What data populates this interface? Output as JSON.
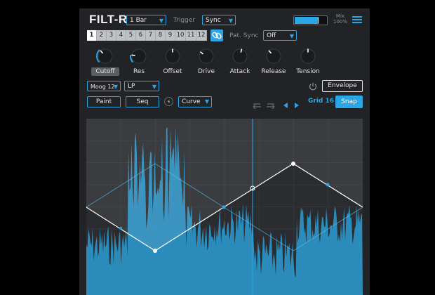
{
  "app": {
    "title": "FILT-R"
  },
  "header": {
    "bar_length": "1 Bar",
    "trigger_label": "Trigger",
    "trigger_value": "Sync",
    "mix_label": "Mix",
    "mix_value": "100%",
    "mix_level": 0.75
  },
  "steps": {
    "items": [
      "1",
      "2",
      "3",
      "4",
      "5",
      "6",
      "7",
      "8",
      "9",
      "10",
      "11",
      "12"
    ],
    "active": "1",
    "pat_sync_label": "Pat. Sync",
    "pat_sync_value": "Off"
  },
  "knobs": [
    {
      "label": "Cutoff",
      "value": 0.35,
      "selected": true
    },
    {
      "label": "Res",
      "value": 0.2,
      "selected": false
    },
    {
      "label": "Offset",
      "value": 0.5,
      "selected": false
    },
    {
      "label": "Drive",
      "value": 0.3,
      "selected": false
    },
    {
      "label": "Attack",
      "value": 0.55,
      "selected": false
    },
    {
      "label": "Release",
      "value": 0.35,
      "selected": false
    },
    {
      "label": "Tension",
      "value": 0.5,
      "selected": false
    }
  ],
  "filter": {
    "model": "Moog 12",
    "type": "LP",
    "envelope_label": "Envelope"
  },
  "toolbar": {
    "paint_label": "Paint",
    "seq_label": "Seq",
    "curve_label": "Curve",
    "grid_label": "Grid 16",
    "snap_label": "Snap"
  },
  "colors": {
    "accent": "#2aa6e6",
    "panel": "#222326",
    "waveform": "#2b9ed4",
    "graph_bg": "#2a2c30"
  }
}
